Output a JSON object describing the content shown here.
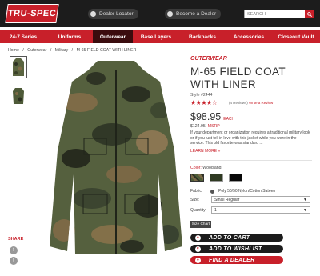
{
  "brand": {
    "logo": "TRU-SPEC",
    "accent": "#c8202a",
    "dark": "#1c1c1c"
  },
  "topbar": {
    "dealer_locator": "Dealer Locator",
    "become_dealer": "Become a Dealer",
    "search_placeholder": "SEARCH",
    "search_btn_icon": "search-icon"
  },
  "nav": {
    "items": [
      "24-7 Series",
      "Uniforms",
      "Outerwear",
      "Base Layers",
      "Backpacks",
      "Accessories",
      "Closeout Vault"
    ],
    "active": "Outerwear"
  },
  "breadcrumbs": [
    "Home",
    "/",
    "Outerwear",
    "/",
    "Military",
    "/",
    "M-65 FIELD COAT WITH LINER"
  ],
  "share": {
    "label": "SHARE"
  },
  "product": {
    "category": "OUTERWEAR",
    "title": "M-65 FIELD COAT WITH LINER",
    "style": "Style #2444",
    "rating_stars": "★★★★☆",
    "rating_value": 4,
    "reviews_count": "(4 Reviews)",
    "write_review": "Write a Review",
    "price": "$98.95",
    "price_suffix": "EACH",
    "msrp_value": "$124.95",
    "msrp_label": "MSRP",
    "description": "If your department or organization requires a traditional military look or if you just fell in love with this jacket while you were in the service. This old favorite was standard ...",
    "learn_more": "LEARN MORE »",
    "color_label": "Color:",
    "color_value": "Woodland",
    "fabric_label": "Fabric:",
    "fabric_value": "Poly 50/50 Nylon/Cotton Sateen",
    "size_label": "Size:",
    "size_value": "Small Regular",
    "quantity_label": "Quantity:",
    "quantity_value": "1",
    "size_chart": "Size Chart",
    "add_to_cart": "ADD TO CART",
    "add_to_wishlist": "ADD TO WISHLIST",
    "find_dealer": "FIND A DEALER"
  }
}
